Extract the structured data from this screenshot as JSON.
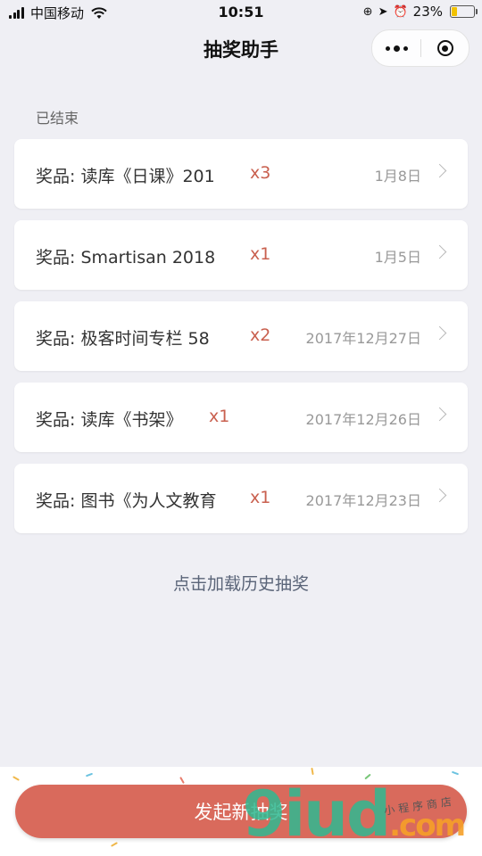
{
  "status_bar": {
    "carrier": "中国移动",
    "time": "10:51",
    "battery_percent": "23%",
    "battery_level": 0.23,
    "icons": [
      "lock-rotation-icon",
      "location-arrow-icon",
      "alarm-icon"
    ]
  },
  "nav": {
    "title": "抽奖助手"
  },
  "section": {
    "title": "已结束"
  },
  "lotteries": [
    {
      "prize": "奖品: 读库《日课》201",
      "qty": "x3",
      "date": "1月8日"
    },
    {
      "prize": "奖品: Smartisan 2018",
      "qty": "x1",
      "date": "1月5日"
    },
    {
      "prize": "奖品: 极客时间专栏 58",
      "qty": "x2",
      "date": "2017年12月27日"
    },
    {
      "prize": "奖品: 读库《书架》",
      "qty": "x1",
      "date": "2017年12月26日"
    },
    {
      "prize": "奖品: 图书《为人文教育",
      "qty": "x1",
      "date": "2017年12月23日"
    }
  ],
  "load_history_label": "点击加载历史抽奖",
  "launch_button_label": "发起新抽奖",
  "watermark": {
    "main": "9iud",
    "suffix": ".com",
    "sub": "小程序商店"
  },
  "colors": {
    "accent": "#d96a5c",
    "qty": "#c9604f",
    "link": "#5a6478",
    "background": "#efeff4"
  }
}
